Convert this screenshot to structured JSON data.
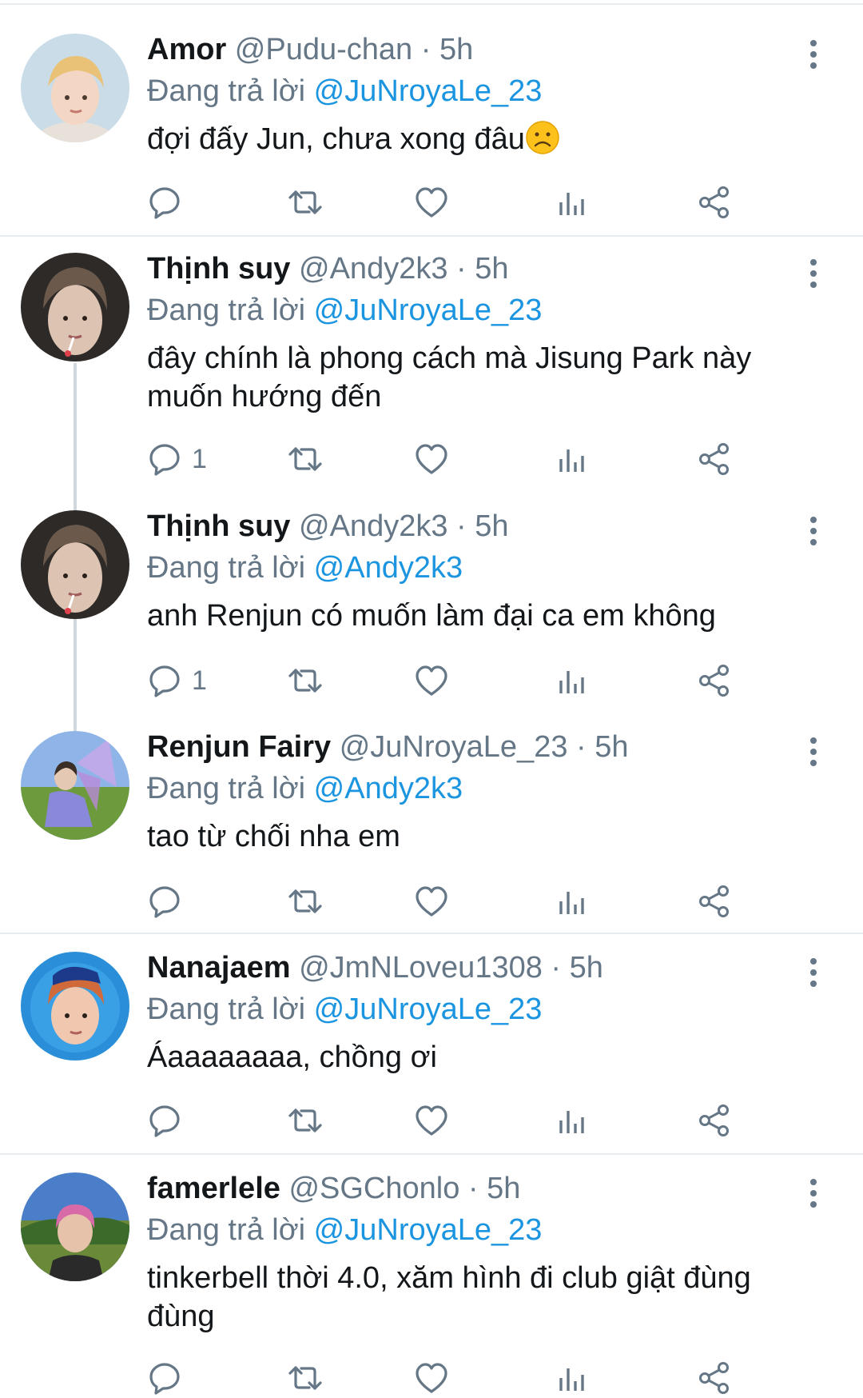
{
  "reply_prefix": "Đang trả lời",
  "colors": {
    "text": "#14171a",
    "muted": "#657786",
    "mention": "#1b95e0",
    "divider": "#e6ecf0"
  },
  "tweets": [
    {
      "name": "Amor",
      "handle": "@Pudu-chan",
      "time": "5h",
      "reply_to": "@JuNroyaLe_23",
      "text": "đợi đấy Jun, chưa xong đâu",
      "emoji": "frowning-face",
      "reply_count": ""
    },
    {
      "name": "Thịnh suy",
      "handle": "@Andy2k3",
      "time": "5h",
      "reply_to": "@JuNroyaLe_23",
      "text": "đây chính là phong cách mà Jisung Park này muốn hướng đến",
      "reply_count": "1"
    },
    {
      "name": "Thịnh suy",
      "handle": "@Andy2k3",
      "time": "5h",
      "reply_to": "@Andy2k3",
      "text": "anh Renjun có muốn làm đại ca em không",
      "reply_count": "1"
    },
    {
      "name": "Renjun Fairy",
      "handle": "@JuNroyaLe_23",
      "time": "5h",
      "reply_to": "@Andy2k3",
      "text": "tao từ chối nha em",
      "reply_count": ""
    },
    {
      "name": "Nanajaem",
      "handle": "@JmNLoveu1308",
      "time": "5h",
      "reply_to": "@JuNroyaLe_23",
      "text": "Áaaaaaaaa, chồng ơi",
      "reply_count": ""
    },
    {
      "name": "famerlele",
      "handle": "@SGChonlo",
      "time": "5h",
      "reply_to": "@JuNroyaLe_23",
      "text": "tinkerbell thời 4.0, xăm hình đi club giật đùng đùng",
      "reply_count": ""
    }
  ],
  "icons": [
    "reply-icon",
    "retweet-icon",
    "like-icon",
    "analytics-icon",
    "share-icon",
    "more-icon"
  ]
}
